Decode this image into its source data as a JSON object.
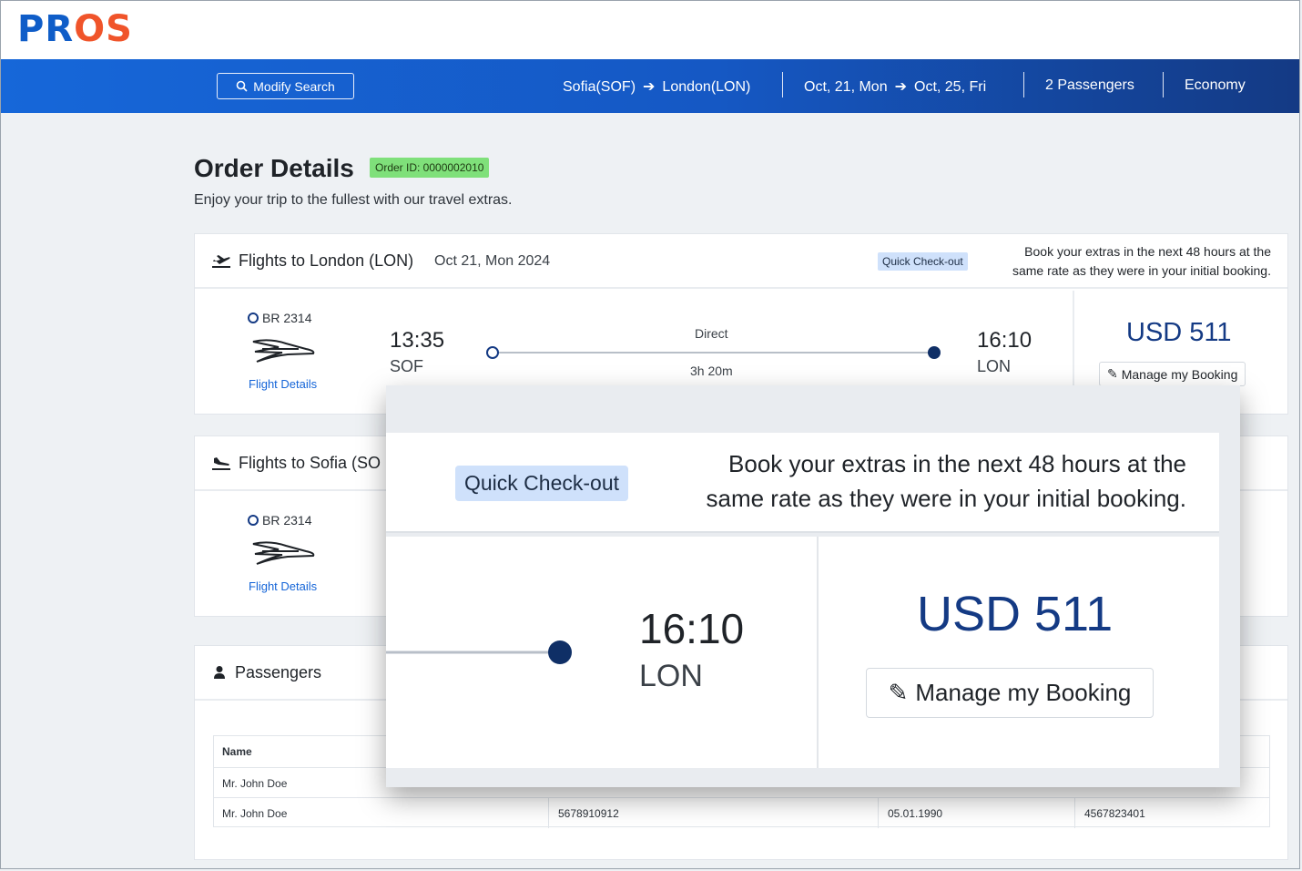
{
  "logo": {
    "text_a": "PR",
    "text_b": "OS"
  },
  "nav": {
    "modify_label": "Modify Search",
    "origin": "Sofia(SOF)",
    "destination": "London(LON)",
    "date_from": "Oct, 21, Mon",
    "date_to": "Oct, 25, Fri",
    "passengers": "2 Passengers",
    "cabin": "Economy"
  },
  "page": {
    "title": "Order Details",
    "order_id": "Order ID: 0000002010",
    "subtitle": "Enjoy your trip to the fullest with our travel extras."
  },
  "outbound": {
    "title": "Flights to London (LON)",
    "date": "Oct 21, Mon 2024",
    "quick_checkout": "Quick Check-out",
    "extras_line1": "Book your extras in the next 48 hours at the",
    "extras_line2": "same rate as they were in your initial booking.",
    "flight_no": "BR 2314",
    "flight_details": "Flight Details",
    "dep_time": "13:35",
    "dep_code": "SOF",
    "stops": "Direct",
    "duration": "3h 20m",
    "arr_time": "16:10",
    "arr_code": "LON",
    "price": "USD 511",
    "manage": "Manage my Booking"
  },
  "return": {
    "title": "Flights to Sofia (SO",
    "flight_no": "BR 2314",
    "flight_details": "Flight Details"
  },
  "passengers": {
    "title": "Passengers",
    "header_name": "Name",
    "rows": [
      {
        "name": "Mr. John Doe",
        "doc": "",
        "dob": "",
        "id": ""
      },
      {
        "name": "Mr. John Doe",
        "doc": "5678910912",
        "dob": "05.01.1990",
        "id": "4567823401"
      }
    ]
  },
  "popup": {
    "quick_checkout": "Quick Check-out",
    "extras_line1": "Book your extras in the next 48 hours at the",
    "extras_line2": "same rate as they were in your initial booking.",
    "arr_time": "16:10",
    "arr_code": "LON",
    "price": "USD 511",
    "manage": "Manage my Booking"
  }
}
